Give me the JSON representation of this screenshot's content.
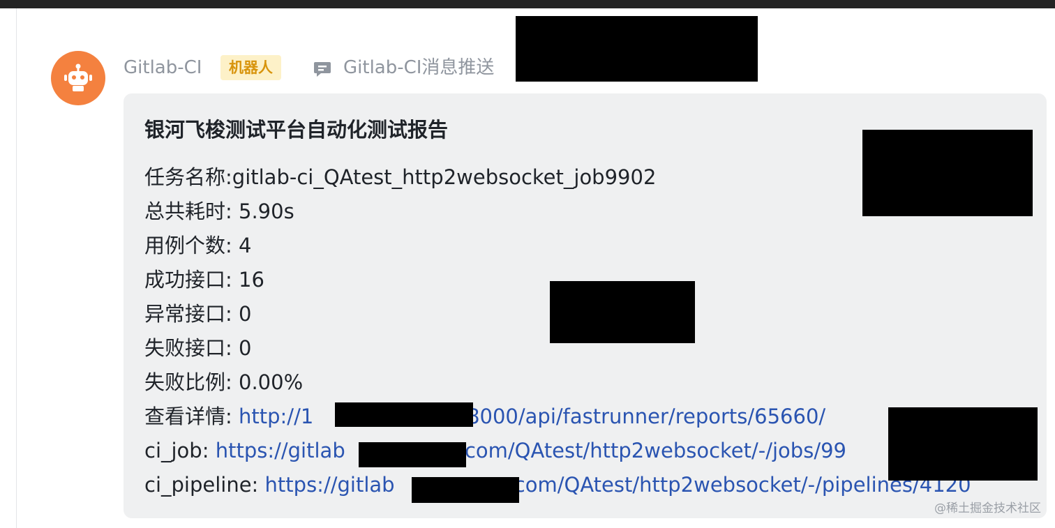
{
  "message": {
    "sender_name": "Gitlab-CI",
    "sender_badge": "机器人",
    "group_name": "Gitlab-CI消息推送"
  },
  "card": {
    "title": "银河飞梭测试平台自动化测试报告",
    "lines": [
      {
        "label": "任务名称:",
        "value": "gitlab-ci_QAtest_http2websocket_job9902"
      },
      {
        "label": "总共耗时: ",
        "value": "5.90s"
      },
      {
        "label": "用例个数: ",
        "value": "4"
      },
      {
        "label": "成功接口: ",
        "value": "16"
      },
      {
        "label": "异常接口: ",
        "value": "0"
      },
      {
        "label": "失败接口: ",
        "value": "0"
      },
      {
        "label": "失败比例: ",
        "value": "0.00%"
      }
    ],
    "links": [
      {
        "label": "查看详情: ",
        "prefix": "http://1",
        "suffix": ":8000/api/fastrunner/reports/65660/"
      },
      {
        "label": "ci_job: ",
        "prefix": "https://gitlab",
        "suffix": ".com/QAtest/http2websocket/-/jobs/99"
      },
      {
        "label": "ci_pipeline: ",
        "prefix": "https://gitlab",
        "suffix": ".com/QAtest/http2websocket/-/pipelines/4120"
      }
    ]
  },
  "watermark": "@稀土掘金技术社区",
  "icons": {
    "avatar": "robot-icon",
    "group": "chat-bubble-icon"
  },
  "colors": {
    "avatar_bg": "#f4813f",
    "badge_bg": "#fdf1c8",
    "badge_text": "#d8940c",
    "link": "#2a54b1",
    "card_bg": "#eff0f1"
  }
}
